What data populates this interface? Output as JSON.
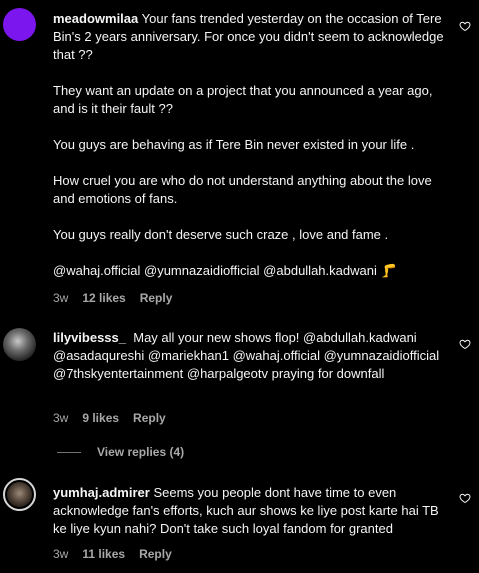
{
  "comments": [
    {
      "username": "meadowmilaa",
      "paragraphs": [
        "Your fans trended yesterday on the occasion of Tere Bin's 2 years anniversary. For once you didn't seem to acknowledge that ??",
        "They want an update on a project that you announced a year ago, and is it their fault ??",
        "You guys are behaving as if Tere Bin never existed in your life .",
        "How cruel you are who do not understand anything about the love and emotions of fans.",
        "You guys really don't deserve such craze , love and fame .",
        "@wahaj.official @yumnazaidiofficial @abdullah.kadwani 🦵"
      ],
      "time": "3w",
      "likes": "12 likes",
      "reply": "Reply"
    },
    {
      "username": "lilyvibesss_",
      "paragraphs": [
        "May all your new shows flop! @abdullah.kadwani @asadaqureshi @mariekhan1 @wahaj.official @yumnazaidiofficial @7thskyentertainment @harpalgeotv praying for downfall"
      ],
      "time": "3w",
      "likes": "9 likes",
      "reply": "Reply"
    },
    {
      "username": "yumhaj.admirer",
      "paragraphs": [
        "Seems you people dont have time to even acknowledge fan's efforts, kuch aur shows ke liye post karte hai TB ke liye kyun nahi? Don't take such loyal fandom for granted"
      ],
      "time": "3w",
      "likes": "11 likes",
      "reply": "Reply"
    }
  ],
  "view_replies": "View replies (4)",
  "colors": {
    "background": "#000000",
    "text": "#f5f5f5",
    "secondary": "#a8a8a8",
    "avatar_purple": "#7c16ef"
  },
  "icons": {
    "like": "heart-icon"
  }
}
